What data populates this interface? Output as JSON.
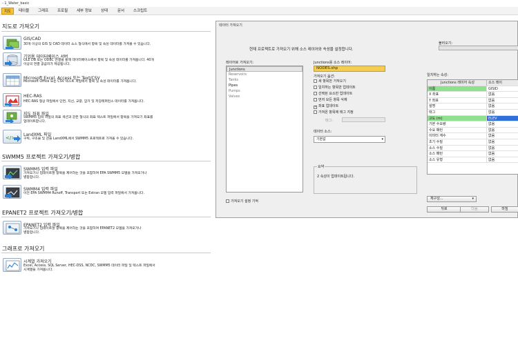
{
  "window": {
    "title": "- 1_Water_basic"
  },
  "menu": [
    "지도",
    "테이블",
    "그래프",
    "프로필",
    "세부 정보",
    "상태",
    "문서",
    "스크립트"
  ],
  "menu_active_index": 0,
  "left": {
    "section1": {
      "title": "지도로 가져오기",
      "items": [
        {
          "icon": "gis-cad-import-icon",
          "title": "GIS/CAD",
          "desc": [
            "30개 이상의 GIS 및 CAD 데이터 소스 형식에서 항목 및 속성 데이터를 가져올 수 있습니다."
          ]
        },
        {
          "icon": "database-server-icon",
          "title": "기업용 데이터베이스 서버",
          "desc": [
            "OLE DB 또는 ODBC 연결을 통해 데이터베이스에서 항목 및 속성 데이터를 가져옵니다. 40개",
            "이상의 연결 공급자가 제공됩니다."
          ]
        },
        {
          "icon": "spreadsheet-icon",
          "title": "Microsoft Excel, Access 또는 Text/CSV",
          "desc": [
            "Microsoft Office 또는 CSV 텍스트 파일에서 항목 및 속성 데이터를 가져옵니다."
          ]
        },
        {
          "icon": "hec-ras-icon",
          "title": "HEC-RAS",
          "desc": [
            "HEC-RAS 형상 파일에서 단면, 지선, 교량, 암거 및 저장레퍼런스 데이터를 가져옵니다."
          ]
        },
        {
          "icon": "coordinate-file-icon",
          "title": "지도 좌표 파일",
          "desc": [
            "SWMM5 입력 파일의 좌표 섹션과 같은 형식의 좌표 텍스트 파일에서 항목을 가져오기 좌표를",
            "업데이트합니다."
          ]
        },
        {
          "icon": "landxml-icon",
          "title": "LandXML 파일",
          "desc": [
            "구획, 구조물 및 관을 LandXML에서 SWMM5 프로젝트로 가져올 수 있습니다."
          ]
        }
      ]
    },
    "section2": {
      "title": "SWMM5 프로젝트 가져오기/병합",
      "items": [
        {
          "icon": "swmm5-import-icon",
          "title": "SWMM5 입력 파일",
          "desc": [
            "가져오기나 업데이트할 항목을 제어하는 것을 포함하여 EPA SWMM5 모델을 가져오거나",
            "병합합니다."
          ]
        },
        {
          "icon": "swmm4-import-icon",
          "title": "SWMM4 입력 파일",
          "desc": [
            "이전 EPA SWMM4 Runoff, Transport 또는 Extran 모델 입력 파일에서 가져옵니다."
          ]
        }
      ]
    },
    "section3": {
      "title": "EPANET2 프로젝트 가져오기/병합",
      "items": [
        {
          "icon": "epanet2-import-icon",
          "title": "EPANET2 입력 파일",
          "desc": [
            "가져오기나 업데이트할 항목을 제어하는 것을 포함하여 EPANET2 모델을 가져오거나",
            "병합합니다."
          ]
        }
      ]
    },
    "section4": {
      "title": "그래프로 가져오기",
      "items": [
        {
          "icon": "time-series-icon",
          "title": "시계열 가져오기",
          "desc": [
            "Excel, Access, SQL Server, HEC-DSS, NCDC, SWMM5 데이터 파일 및 텍스트 파일에서",
            "시계열을 가져옵니다."
          ]
        }
      ]
    }
  },
  "dialog": {
    "title": "데이터 가져오기",
    "instruction": "현재 프로젝트로 가져오기 위해 소스 레이어와 속성을 설정합니다.",
    "progress_label": "불러오기:",
    "progress": 0,
    "import_to_label": "레이어로 가져오기:",
    "layers": [
      "Junctions",
      "Reservoirs",
      "Tanks",
      "Pipes",
      "Pumps",
      "Valves"
    ],
    "selected_layer_index": 0,
    "source_layer_label": "Junctions용 소스 레이어:",
    "source_layer_value": "NODES.shp",
    "options_label": "가져오기 옵션:",
    "options": [
      {
        "label": "새 항목만 가져오기",
        "checked": false
      },
      {
        "label": "일치하는 항목만 업데이트",
        "checked": false
      },
      {
        "label": "선택된 요소만 업데이트",
        "checked": false
      },
      {
        "label": "먼저 모든 항목 삭제",
        "checked": false
      },
      {
        "label": "좌표 업데이트",
        "checked": true
      },
      {
        "label": "가져온 항목에 태그 지정",
        "checked": false
      }
    ],
    "tag_label": "태그:",
    "data_source_label": "데이터 소스:",
    "data_source_value": "기본값",
    "summary_label": "요약",
    "summary_text": "2 속성이 업데이트됩니다.",
    "remember_label": "가져오기 설정 기억",
    "matching_label": "일치하는 속성:",
    "grid_headers": [
      "Junctions 레이어 속성",
      "소스 레이"
    ],
    "grid_rows": [
      {
        "attr": "이름",
        "source": "GISID",
        "highlight": "green"
      },
      {
        "attr": "X 좌표",
        "source": "없음",
        "highlight": ""
      },
      {
        "attr": "Y 좌표",
        "source": "없음",
        "highlight": ""
      },
      {
        "attr": "설명",
        "source": "없음",
        "highlight": ""
      },
      {
        "attr": "태그",
        "source": "없음",
        "highlight": ""
      },
      {
        "attr": "고도 (m)",
        "source": "ELEV",
        "highlight": "blue"
      },
      {
        "attr": "기본 수요량",
        "source": "없음",
        "highlight": ""
      },
      {
        "attr": "수요 패턴",
        "source": "없음",
        "highlight": ""
      },
      {
        "attr": "이미터 계수",
        "source": "없음",
        "highlight": ""
      },
      {
        "attr": "초기 수질",
        "source": "없음",
        "highlight": ""
      },
      {
        "attr": "소스 수질",
        "source": "없음",
        "highlight": ""
      },
      {
        "attr": "소스 패턴",
        "source": "없음",
        "highlight": ""
      },
      {
        "attr": "소스 유형",
        "source": "없음",
        "highlight": ""
      }
    ],
    "buttons": {
      "reset": "재구성...",
      "back": "뒤로",
      "next": "다음",
      "finish": "마침"
    },
    "colors": {
      "source_layer_fill": "#f3ce53",
      "match_green": "#8fe08f",
      "match_blue": "#2f6fd8"
    }
  }
}
